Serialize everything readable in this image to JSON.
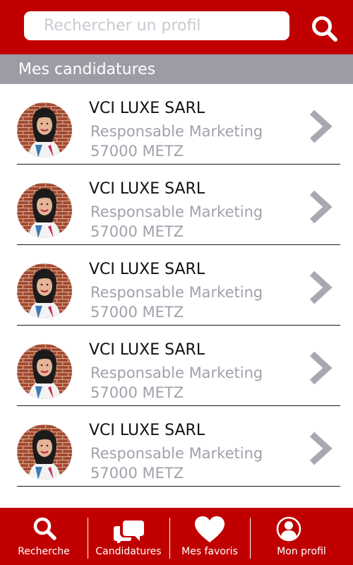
{
  "header": {
    "search_placeholder": "Rechercher un profil",
    "search_icon": "search-icon"
  },
  "section": {
    "title": "Mes candidatures"
  },
  "applications": [
    {
      "company": "VCI LUXE SARL",
      "position": "Responsable Marketing",
      "location": "57000 METZ"
    },
    {
      "company": "VCI LUXE SARL",
      "position": "Responsable Marketing",
      "location": "57000 METZ"
    },
    {
      "company": "VCI LUXE SARL",
      "position": "Responsable Marketing",
      "location": "57000 METZ"
    },
    {
      "company": "VCI LUXE SARL",
      "position": "Responsable Marketing",
      "location": "57000 METZ"
    },
    {
      "company": "VCI LUXE SARL",
      "position": "Responsable Marketing",
      "location": "57000 METZ"
    }
  ],
  "bottom_nav": {
    "items": [
      {
        "label": "Recherche",
        "icon": "search-icon"
      },
      {
        "label": "Candidatures",
        "icon": "chat-bubbles-icon"
      },
      {
        "label": "Mes favoris",
        "icon": "heart-icon"
      },
      {
        "label": "Mon profil",
        "icon": "user-icon"
      }
    ]
  },
  "colors": {
    "primary": "#c00000",
    "section_header": "#9c9ca6",
    "secondary_text": "#a1a1ab",
    "chevron": "#a8a8b2"
  }
}
